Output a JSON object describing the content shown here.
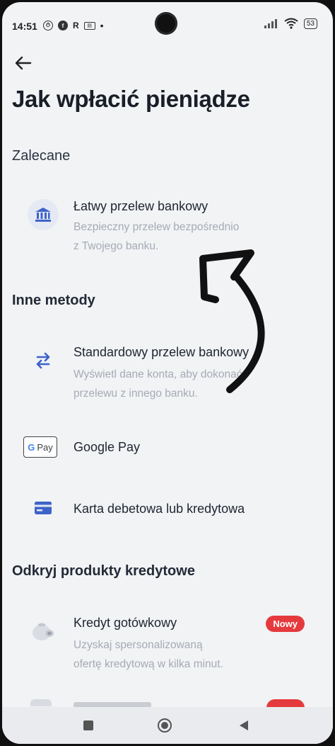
{
  "status_bar": {
    "time": "14:51",
    "icons": [
      "alarm-icon",
      "facebook-icon",
      "r-app-icon",
      "notification-icon",
      "more-dot"
    ],
    "battery": "53"
  },
  "header": {
    "back_icon": "arrow-left-icon",
    "title": "Jak wpłacić pieniądze"
  },
  "sections": {
    "recommended": {
      "title": "Zalecane",
      "items": [
        {
          "icon": "bank-icon",
          "label": "Łatwy przelew bankowy",
          "desc_line1": "Bezpieczny przelew bezpośrednio",
          "desc_line2": "z Twojego banku."
        }
      ]
    },
    "other_methods": {
      "title": "Inne metody",
      "items": [
        {
          "icon": "transfer-arrows-icon",
          "label": "Standardowy przelew bankowy",
          "desc_line1": "Wyświetl dane konta, aby dokonać",
          "desc_line2": "przelewu z innego banku."
        },
        {
          "icon": "google-pay-icon",
          "icon_text_g": "G",
          "icon_text": "Pay",
          "label": "Google Pay"
        },
        {
          "icon": "card-icon",
          "label": "Karta debetowa lub kredytowa"
        }
      ]
    },
    "credit_products": {
      "title": "Odkryj produkty kredytowe",
      "items": [
        {
          "icon": "money-bag-icon",
          "label": "Kredyt gotówkowy",
          "badge": "Nowy",
          "desc_line1": "Uzyskaj spersonalizowaną",
          "desc_line2": "ofertę kredytową w kilka minut."
        }
      ]
    }
  },
  "navigation": {
    "items": [
      "recents-square-icon",
      "home-circle-icon",
      "back-triangle-icon"
    ]
  },
  "colors": {
    "background": "#f1f3f5",
    "accent_blue": "#3d63c9",
    "badge_red": "#e53a3d",
    "muted_text": "#a6abb4"
  }
}
